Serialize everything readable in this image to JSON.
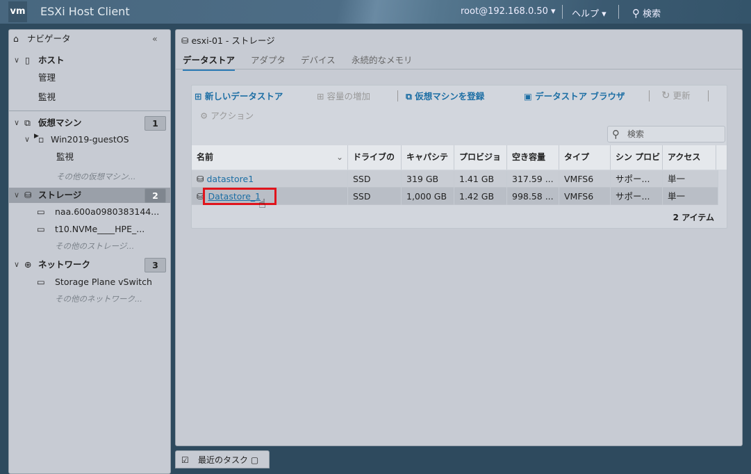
{
  "header": {
    "logo": "vm",
    "title": "ESXi Host Client",
    "user": "root@192.168.0.50",
    "help": "ヘルプ",
    "search": "検索"
  },
  "navigator": {
    "title": "ナビゲータ",
    "items": [
      {
        "label": "ホスト"
      },
      {
        "label": "管理"
      },
      {
        "label": "監視"
      },
      {
        "label": "仮想マシン",
        "badge": "1"
      },
      {
        "label": "Win2019-guestOS"
      },
      {
        "label": "監視"
      },
      {
        "label": "その他の仮想マシン..."
      },
      {
        "label": "ストレージ",
        "badge": "2"
      },
      {
        "label": "naa.600a0980383144..."
      },
      {
        "label": "t10.NVMe____HPE_..."
      },
      {
        "label": "その他のストレージ..."
      },
      {
        "label": "ネットワーク",
        "badge": "3"
      },
      {
        "label": "Storage Plane vSwitch"
      },
      {
        "label": "その他のネットワーク..."
      }
    ]
  },
  "main": {
    "title": "esxi-01 - ストレージ",
    "tabs": [
      "データストア",
      "アダプタ",
      "デバイス",
      "永続的なメモリ"
    ],
    "toolbar": {
      "new": "新しいデータストア",
      "increase": "容量の増加",
      "register": "仮想マシンを登録",
      "browser": "データストア ブラウザ",
      "refresh": "更新",
      "actions": "アクション"
    },
    "search_placeholder": "検索",
    "columns": [
      "名前",
      "ドライブの",
      "キャパシテ",
      "プロビジョ",
      "空き容量",
      "タイプ",
      "シン プロビ",
      "アクセス"
    ],
    "rows": [
      [
        "datastore1",
        "SSD",
        "319 GB",
        "1.41 GB",
        "317.59 ...",
        "VMFS6",
        "サポー...",
        "単一"
      ],
      [
        "Datastore_1",
        "SSD",
        "1,000 GB",
        "1.42 GB",
        "998.58 ...",
        "VMFS6",
        "サポー...",
        "単一"
      ]
    ],
    "footer": "2 アイテム"
  },
  "bottom": {
    "recent_tasks": "最近のタスク"
  }
}
